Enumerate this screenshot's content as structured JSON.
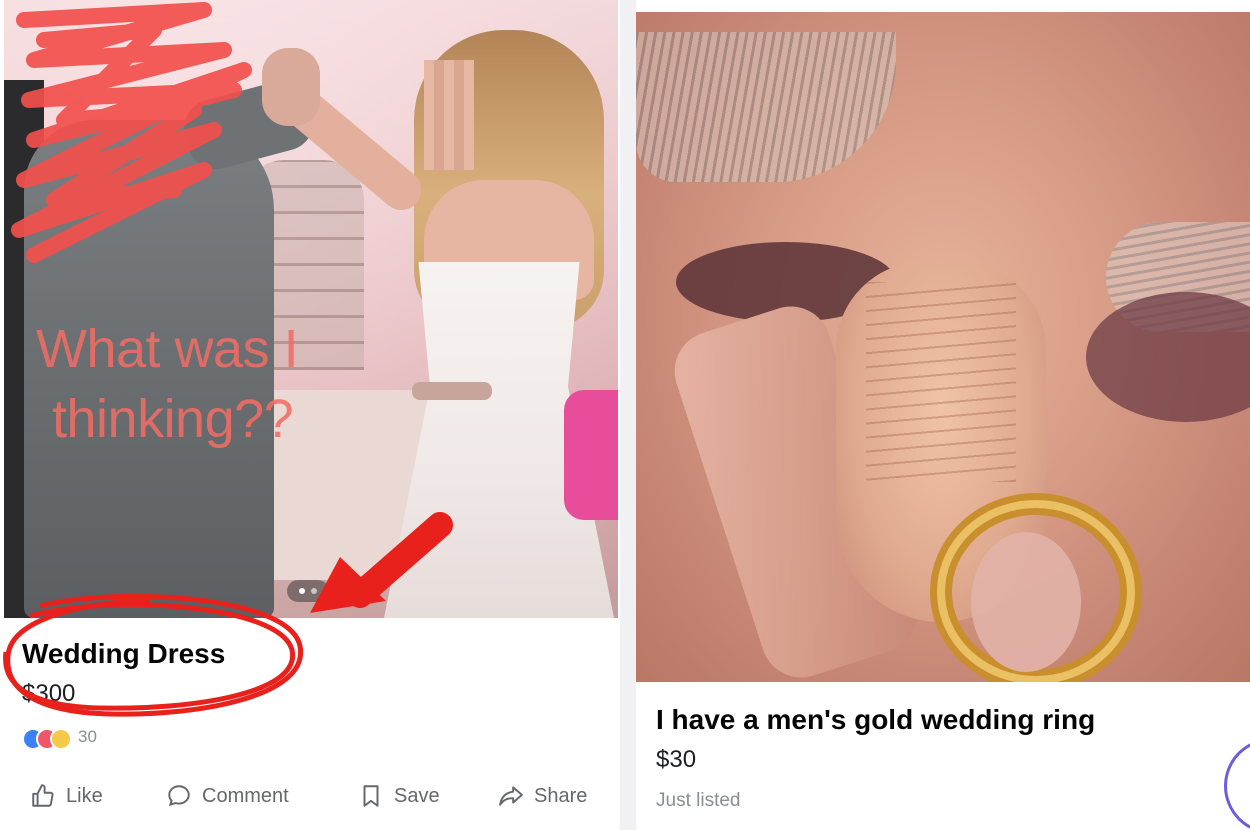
{
  "left_listing": {
    "overlay_text": {
      "line1": "What was I",
      "line2": "thinking??"
    },
    "title": "Wedding Dress",
    "price": "$300",
    "reaction_count": "30",
    "actions": {
      "like": "Like",
      "comment": "Comment",
      "save": "Save",
      "share": "Share"
    },
    "annotation_color": "#e8211c",
    "overlay_text_color": "#f06c64"
  },
  "right_listing": {
    "title": "I have a men's gold wedding ring",
    "price": "$30",
    "status": "Just listed"
  },
  "colors": {
    "action_gray": "#65676b",
    "messenger_accent": "#6d5ce0"
  }
}
